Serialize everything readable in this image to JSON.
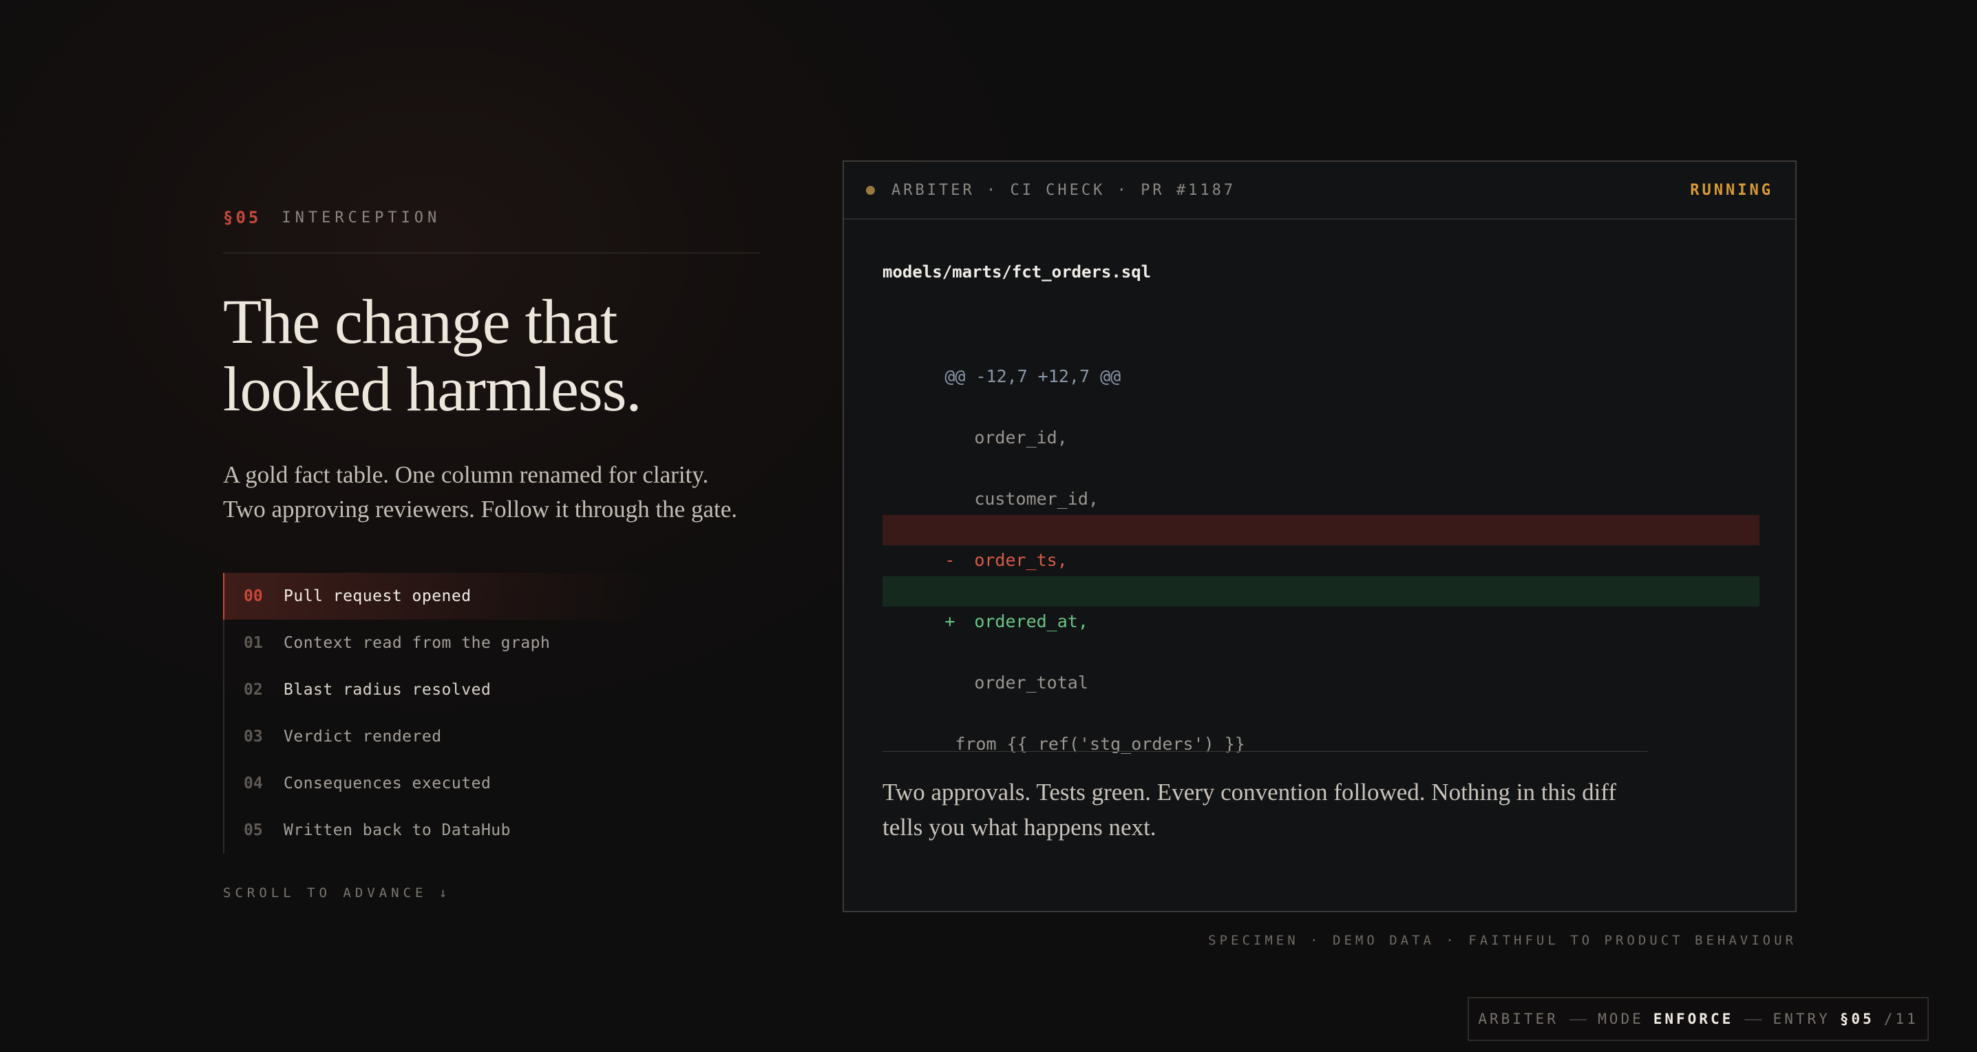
{
  "section": {
    "number": "§05",
    "name": "INTERCEPTION"
  },
  "headline": {
    "line1": "The change that",
    "line2": "looked harmless."
  },
  "lede": {
    "line1": "A gold fact table. One column renamed for clarity.",
    "line2": "Two approving reviewers. Follow it through the gate."
  },
  "steps": [
    {
      "num": "00",
      "label": "Pull request opened",
      "active": true
    },
    {
      "num": "01",
      "label": "Context read from the graph",
      "active": false
    },
    {
      "num": "02",
      "label": "Blast radius resolved",
      "active": false
    },
    {
      "num": "03",
      "label": "Verdict rendered",
      "active": false
    },
    {
      "num": "04",
      "label": "Consequences executed",
      "active": false
    },
    {
      "num": "05",
      "label": "Written back to DataHub",
      "active": false
    }
  ],
  "scroll_hint": "SCROLL TO ADVANCE ↓",
  "panel": {
    "title": "ARBITER · CI CHECK · PR #1187",
    "status": "RUNNING",
    "file_path": "models/marts/fct_orders.sql",
    "diff": [
      {
        "type": "hunk",
        "sign": "",
        "code": "@@ -12,7 +12,7 @@"
      },
      {
        "type": "context",
        "sign": "",
        "code": "order_id,"
      },
      {
        "type": "context",
        "sign": "",
        "code": "customer_id,"
      },
      {
        "type": "removed",
        "sign": "-",
        "code": "order_ts,"
      },
      {
        "type": "added",
        "sign": "+",
        "code": "ordered_at,"
      },
      {
        "type": "context",
        "sign": "",
        "code": "order_total"
      },
      {
        "type": "from",
        "sign": "",
        "code": " from {{ ref('stg_orders') }}"
      }
    ],
    "caption": {
      "line1": "Two approvals. Tests green. Every convention followed. Nothing in this diff",
      "line2": "tells you what happens next."
    }
  },
  "specimen_note": "SPECIMEN · DEMO DATA · FAITHFUL TO PRODUCT BEHAVIOUR",
  "footer_chip": {
    "app": "ARBITER",
    "mode_label": "MODE",
    "mode_value": "ENFORCE",
    "entry_label": "ENTRY",
    "entry_value": "§05",
    "entry_total": "/11",
    "separator": "——"
  },
  "colors": {
    "accent_red": "#c8483a",
    "running_amber": "#d99a36",
    "diff_removed": "#d75a48",
    "diff_added": "#69c485"
  },
  "icons": {
    "status_dot": "dot-icon",
    "scroll_arrow": "arrow-down-icon"
  }
}
